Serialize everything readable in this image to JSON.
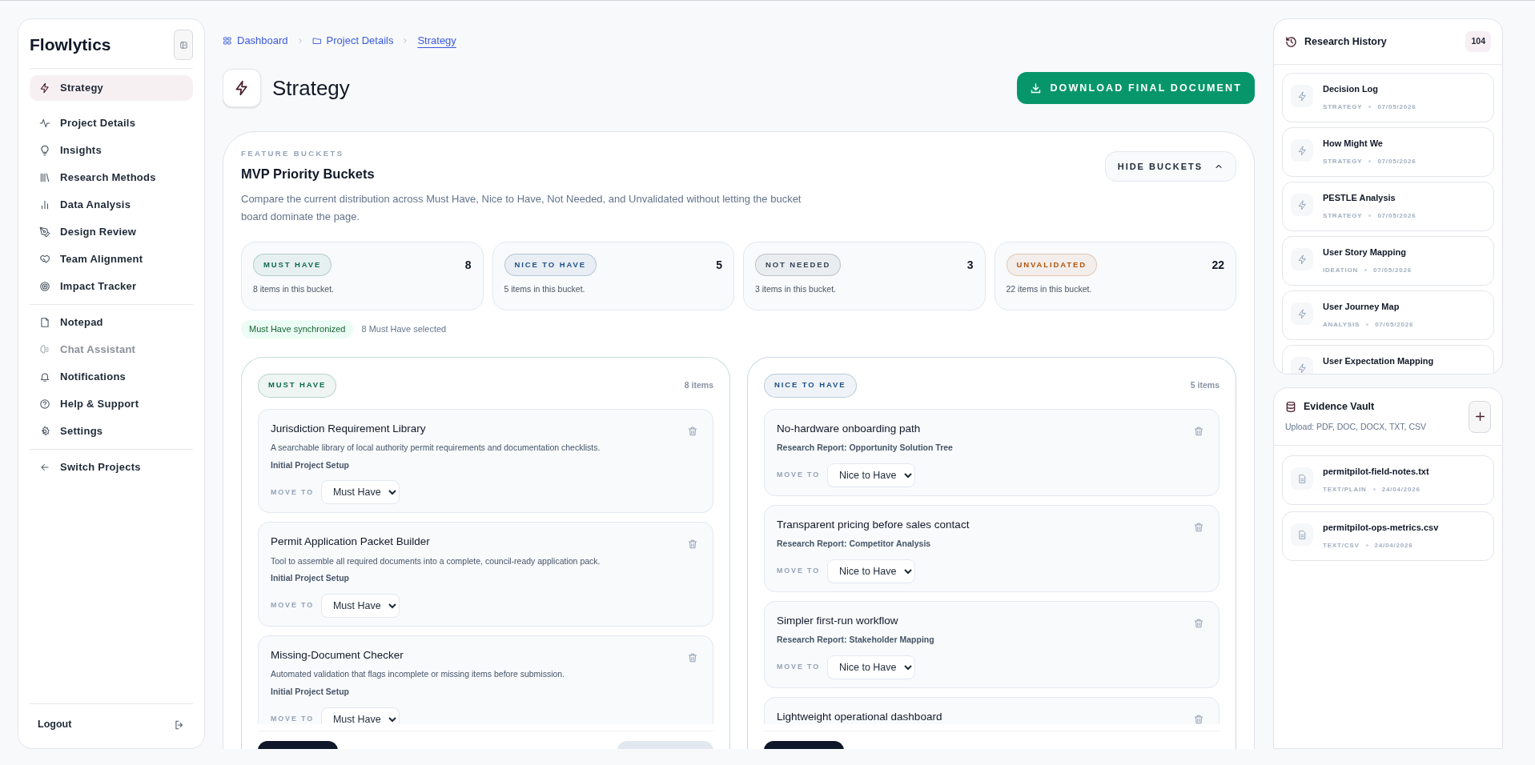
{
  "sidebar": {
    "brand": "Flowlytics",
    "groups": [
      [
        {
          "label": "Strategy",
          "selected": true,
          "disabled": false
        },
        {
          "label": "Project Details",
          "selected": false,
          "disabled": false
        },
        {
          "label": "Insights",
          "selected": false,
          "disabled": false
        },
        {
          "label": "Research Methods",
          "selected": false,
          "disabled": false
        },
        {
          "label": "Data Analysis",
          "selected": false,
          "disabled": false
        },
        {
          "label": "Design Review",
          "selected": false,
          "disabled": false
        },
        {
          "label": "Team Alignment",
          "selected": false,
          "disabled": false
        },
        {
          "label": "Impact Tracker",
          "selected": false,
          "disabled": false
        }
      ],
      [
        {
          "label": "Notepad",
          "selected": false,
          "disabled": false
        },
        {
          "label": "Chat Assistant",
          "selected": false,
          "disabled": true
        },
        {
          "label": "Notifications",
          "selected": false,
          "disabled": false
        },
        {
          "label": "Help & Support",
          "selected": false,
          "disabled": false
        },
        {
          "label": "Settings",
          "selected": false,
          "disabled": false
        }
      ],
      [
        {
          "label": "Switch Projects",
          "selected": false,
          "disabled": false
        }
      ]
    ],
    "footer": "Logout"
  },
  "breadcrumb": [
    {
      "label": "Dashboard",
      "current": false
    },
    {
      "label": "Project Details",
      "current": false
    },
    {
      "label": "Strategy",
      "current": true
    }
  ],
  "page": {
    "title": "Strategy",
    "download_button": "DOWNLOAD FINAL DOCUMENT"
  },
  "buckets": {
    "eyebrow": "FEATURE BUCKETS",
    "title": "MVP Priority Buckets",
    "description": "Compare the current distribution across Must Have, Nice to Have, Not Needed, and Unvalidated without letting the bucket board dominate the page.",
    "toggle_button": "HIDE BUCKETS",
    "summary": [
      {
        "label": "MUST HAVE",
        "count": "8",
        "caption": "8 items in this bucket.",
        "color": "#0f6b4f"
      },
      {
        "label": "NICE TO HAVE",
        "count": "5",
        "caption": "5 items in this bucket.",
        "color": "#1e4f8a"
      },
      {
        "label": "NOT NEEDED",
        "count": "3",
        "caption": "3 items in this bucket.",
        "color": "#334155"
      },
      {
        "label": "UNVALIDATED",
        "count": "22",
        "caption": "22 items in this bucket.",
        "color": "#b45309"
      }
    ],
    "status": {
      "badge": "Must Have synchronized",
      "note": "8 Must Have selected"
    },
    "boards": [
      {
        "label": "MUST HAVE",
        "color": "#0f6b4f",
        "count": "8 items",
        "items": [
          {
            "title": "Jurisdiction Requirement Library",
            "description": "A searchable library of local authority permit requirements and documentation checklists.",
            "source": "Initial Project Setup",
            "move_label": "MOVE TO",
            "move_to": "Must Have"
          },
          {
            "title": "Permit Application Packet Builder",
            "description": "Tool to assemble all required documents into a complete, council-ready application pack.",
            "source": "Initial Project Setup",
            "move_label": "MOVE TO",
            "move_to": "Must Have"
          },
          {
            "title": "Missing-Document Checker",
            "description": "Automated validation that flags incomplete or missing items before submission.",
            "source": "Initial Project Setup",
            "move_label": "MOVE TO",
            "move_to": "Must Have"
          }
        ]
      },
      {
        "label": "NICE TO HAVE",
        "color": "#1e4f8a",
        "count": "5 items",
        "items": [
          {
            "title": "No-hardware onboarding path",
            "source": "Research Report: Opportunity Solution Tree",
            "move_label": "MOVE TO",
            "move_to": "Nice to Have"
          },
          {
            "title": "Transparent pricing before sales contact",
            "source": "Research Report: Competitor Analysis",
            "move_label": "MOVE TO",
            "move_to": "Nice to Have"
          },
          {
            "title": "Simpler first-run workflow",
            "source": "Research Report: Stakeholder Mapping",
            "move_label": "MOVE TO",
            "move_to": "Nice to Have"
          },
          {
            "title": "Lightweight operational dashboard"
          }
        ]
      }
    ]
  },
  "research_history": {
    "title": "Research History",
    "count": "104",
    "items": [
      {
        "title": "Decision Log",
        "category": "STRATEGY",
        "date": "07/05/2026"
      },
      {
        "title": "How Might We",
        "category": "STRATEGY",
        "date": "07/05/2026"
      },
      {
        "title": "PESTLE Analysis",
        "category": "STRATEGY",
        "date": "07/05/2026"
      },
      {
        "title": "User Story Mapping",
        "category": "IDEATION",
        "date": "07/05/2026"
      },
      {
        "title": "User Journey Map",
        "category": "ANALYSIS",
        "date": "07/05/2026"
      },
      {
        "title": "User Expectation Mapping"
      }
    ]
  },
  "evidence_vault": {
    "title": "Evidence Vault",
    "hint": "Upload: PDF, DOC, DOCX, TXT, CSV",
    "files": [
      {
        "name": "permitpilot-field-notes.txt",
        "type": "TEXT/PLAIN",
        "date": "24/04/2026"
      },
      {
        "name": "permitpilot-ops-metrics.csv",
        "type": "TEXT/CSV",
        "date": "24/04/2026"
      }
    ]
  }
}
